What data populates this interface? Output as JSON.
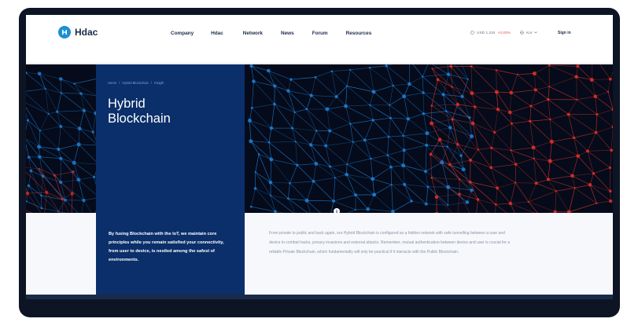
{
  "header": {
    "logo_text": "Hdac",
    "nav": [
      "Company",
      "Hdac",
      "Network",
      "News",
      "Forum",
      "Resources"
    ],
    "price_label": "USD 1,234",
    "price_delta": "+0.00%",
    "language": "Kor",
    "signin_label": "Sign in"
  },
  "hero": {
    "breadcrumb": [
      "Home",
      "Hybrid Blockchain",
      "Insight"
    ],
    "title_line1": "Hybrid",
    "title_line2": "Blockchain"
  },
  "panel_text": "By fusing Blockchain with the IoT, we maintain core principles while you remain satisfied your connectivity, from user to device, is nestled among the safest of environments.",
  "description": "From private to public and back again, our Hybrid Blockchain is configured as a hidden network with safe tunnelling between a user and device to combat hacks, privacy invasions and external attacks. Remember, mutual authentication between device and user is crucial for a reliable Private Blockchain, which fundamentally will only be practical if it interacts with the Public Blockchain.",
  "colors": {
    "brand": "#1c8fd6",
    "panel": "#0a2f6a",
    "network_blue": "#1e7fd8",
    "network_red": "#e0332b"
  }
}
